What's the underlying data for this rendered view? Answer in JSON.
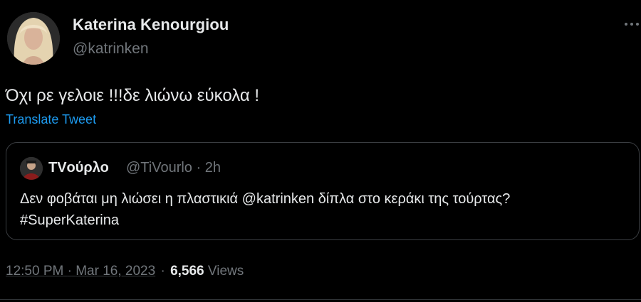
{
  "author": {
    "name": "Katerina Kenourgiou",
    "handle": "@katrinken"
  },
  "tweet": {
    "text": "Όχι ρε γελοιε !!!δε λιώνω εύκολα !",
    "translate_label": "Translate Tweet"
  },
  "quoted_tweet": {
    "name": "TVούρλο",
    "handle": "@TiVourlo",
    "separator": "·",
    "time": "2h",
    "line1": "Δεν φοβάται μη λιώσει η πλαστικιά @katrinken δίπλα στο κεράκι της τούρτας?",
    "line2": "#SuperKaterina"
  },
  "footer": {
    "time": "12:50 PM",
    "separator": "·",
    "date": "Mar 16, 2023",
    "views_count": "6,566",
    "views_label": "Views"
  },
  "icons": {
    "more": "more-horizontal-icon"
  },
  "colors": {
    "background": "#000000",
    "primary_text": "#e7e9ea",
    "secondary_text": "#71767b",
    "link": "#1d9bf0",
    "border": "#3a3d41"
  }
}
